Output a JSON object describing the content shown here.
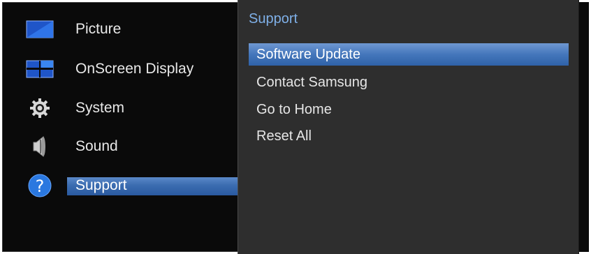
{
  "left_menu": {
    "items": [
      {
        "label": "Picture",
        "icon": "picture-icon",
        "selected": false
      },
      {
        "label": "OnScreen Display",
        "icon": "onscreen-display-icon",
        "selected": false
      },
      {
        "label": "System",
        "icon": "gear-icon",
        "selected": false
      },
      {
        "label": "Sound",
        "icon": "speaker-icon",
        "selected": false
      },
      {
        "label": "Support",
        "icon": "question-icon",
        "selected": true
      }
    ]
  },
  "submenu": {
    "title": "Support",
    "items": [
      {
        "label": "Software Update",
        "selected": true
      },
      {
        "label": "Contact Samsung",
        "selected": false
      },
      {
        "label": "Go to Home",
        "selected": false
      },
      {
        "label": "Reset All",
        "selected": false
      }
    ]
  },
  "colors": {
    "accent": "#3b6cb0",
    "title": "#7fb0e8",
    "panel_bg": "#2e2e2e",
    "menu_bg": "#0a0a0a"
  }
}
